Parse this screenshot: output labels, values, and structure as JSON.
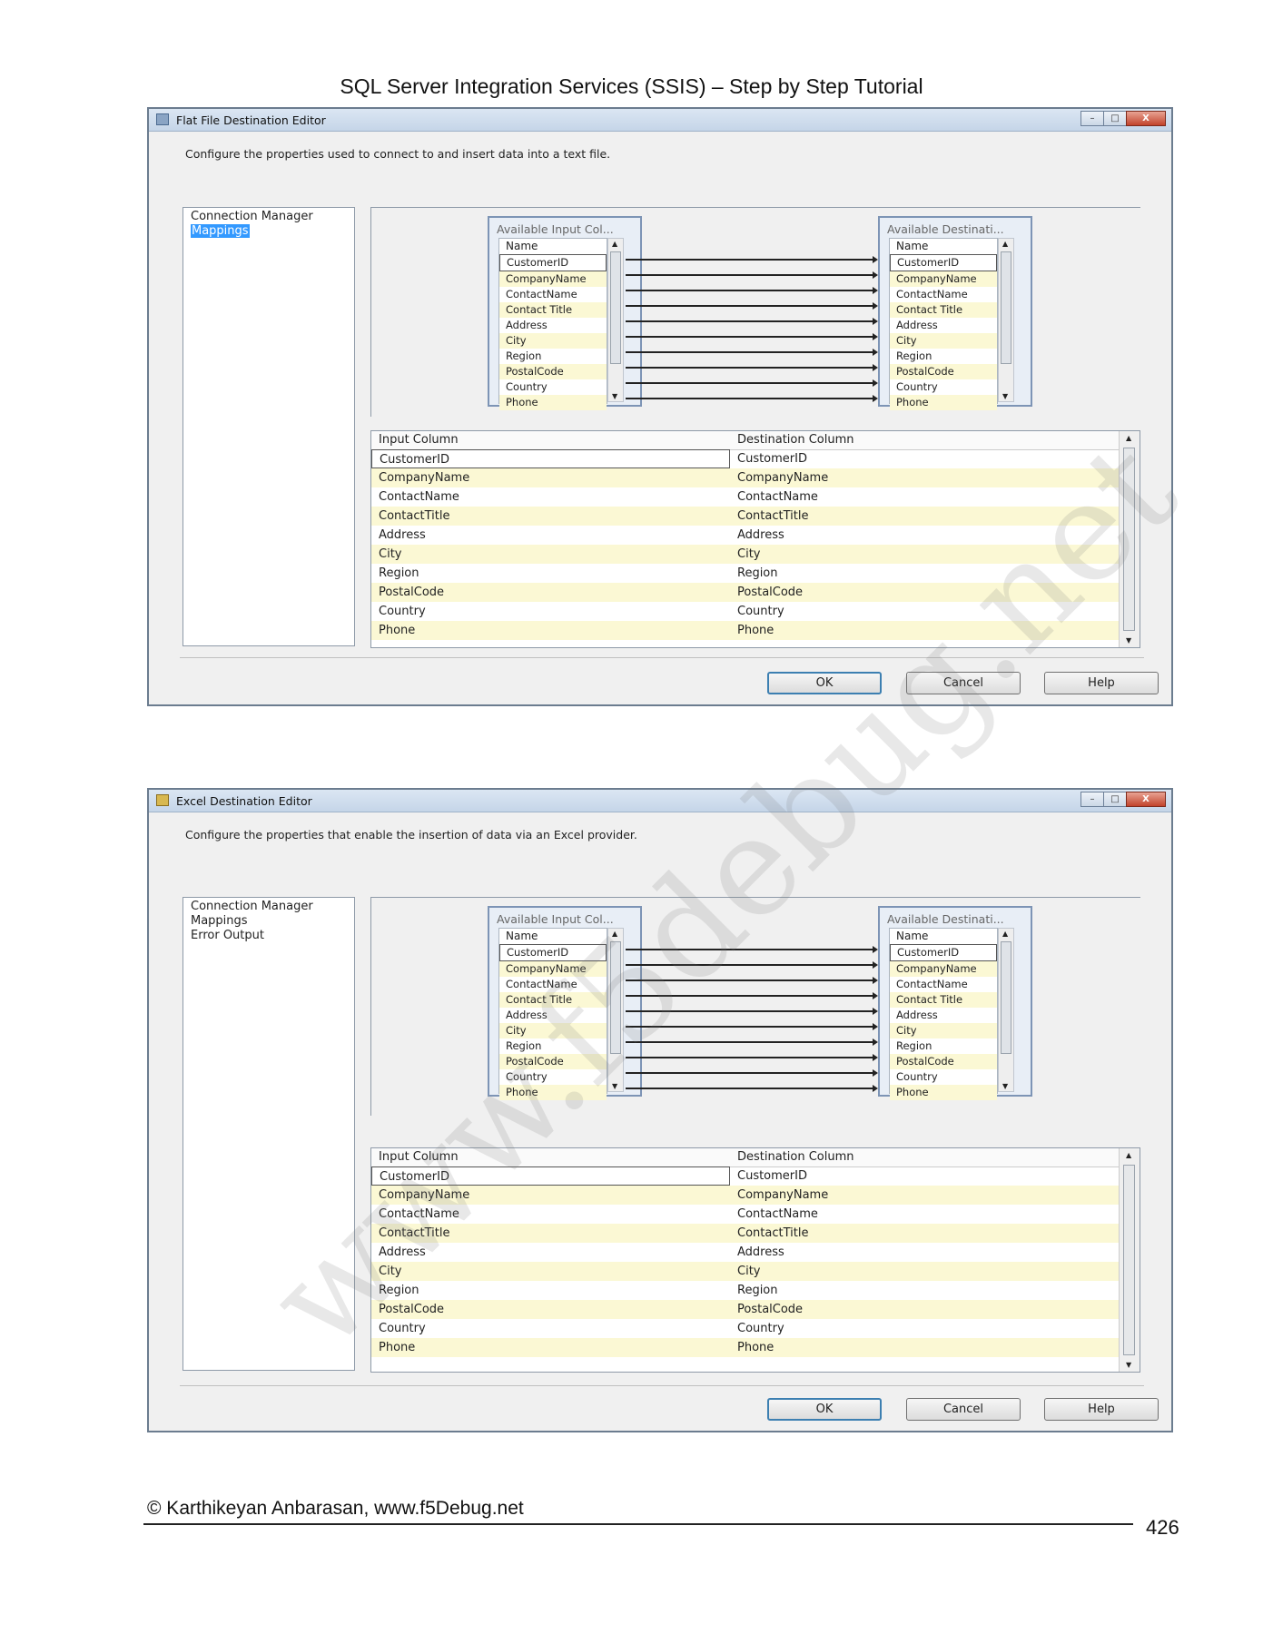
{
  "page": {
    "header": "SQL Server Integration Services (SSIS) – Step by Step Tutorial",
    "footer": "© Karthikeyan Anbarasan, www.f5Debug.net",
    "page_number": "426",
    "watermark": "www.f5debug.net"
  },
  "dialogs": [
    {
      "title": "Flat File Destination Editor",
      "description": "Configure the properties used to connect to and insert data into a text file.",
      "nav": [
        "Connection Manager",
        "Mappings"
      ],
      "selected_nav": 1,
      "available_input_caption": "Available Input Col...",
      "available_dest_caption": "Available Destinati...",
      "list_header": "Name",
      "grid_headers": [
        "Input Column",
        "Destination Column"
      ],
      "buttons": {
        "ok": "OK",
        "cancel": "Cancel",
        "help": "Help"
      }
    },
    {
      "title": "Excel Destination Editor",
      "description": "Configure the properties that enable the insertion of data via an Excel provider.",
      "nav": [
        "Connection Manager",
        "Mappings",
        "Error Output"
      ],
      "selected_nav": -1,
      "available_input_caption": "Available Input Col...",
      "available_dest_caption": "Available Destinati...",
      "list_header": "Name",
      "grid_headers": [
        "Input Column",
        "Destination Column"
      ],
      "buttons": {
        "ok": "OK",
        "cancel": "Cancel",
        "help": "Help"
      }
    }
  ],
  "columns": [
    "CustomerID",
    "CompanyName",
    "ContactName",
    "ContactTitle",
    "Address",
    "City",
    "Region",
    "PostalCode",
    "Country",
    "Phone"
  ],
  "list_columns": [
    "CustomerID",
    "CompanyName",
    "ContactName",
    "Contact Title",
    "Address",
    "City",
    "Region",
    "PostalCode",
    "Country",
    "Phone"
  ],
  "window_buttons": {
    "minimize": "–",
    "maximize": "□",
    "close": "X"
  }
}
